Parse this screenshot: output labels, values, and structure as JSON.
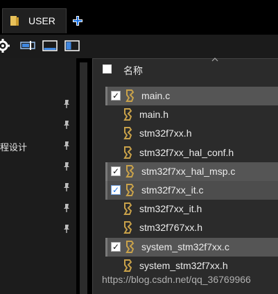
{
  "tab": {
    "label": "USER"
  },
  "left_pane": {
    "text": "程设计",
    "pin_count": 7
  },
  "dropdown": {
    "header_label": "名称",
    "files": [
      {
        "name": "main.c",
        "checked": true,
        "highlighted": true
      },
      {
        "name": "main.h",
        "checked": false,
        "highlighted": false
      },
      {
        "name": "stm32f7xx.h",
        "checked": false,
        "highlighted": false
      },
      {
        "name": "stm32f7xx_hal_conf.h",
        "checked": false,
        "highlighted": false
      },
      {
        "name": "stm32f7xx_hal_msp.c",
        "checked": true,
        "highlighted": true
      },
      {
        "name": "stm32f7xx_it.c",
        "checked": true,
        "highlighted": true,
        "focused": true
      },
      {
        "name": "stm32f7xx_it.h",
        "checked": false,
        "highlighted": false
      },
      {
        "name": "stm32f767xx.h",
        "checked": false,
        "highlighted": false
      },
      {
        "name": "system_stm32f7xx.c",
        "checked": true,
        "highlighted": true
      },
      {
        "name": "system_stm32f7xx.h",
        "checked": false,
        "highlighted": false
      }
    ]
  },
  "watermark": "https://blog.csdn.net/qq_36769966",
  "colors": {
    "accent_blue": "#1a73e8",
    "folder_yellow": "#e8c15a",
    "file_icon_gold": "#c9a24a"
  }
}
